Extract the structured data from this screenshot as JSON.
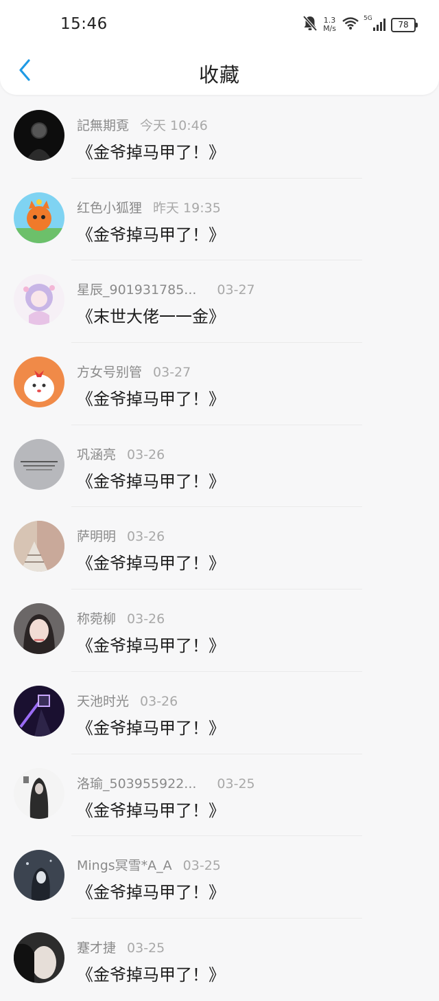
{
  "status_bar": {
    "time": "15:46",
    "net_speed_value": "1.3",
    "net_speed_unit": "M/s",
    "signal_label": "5G",
    "battery": "78"
  },
  "nav": {
    "title": "收藏",
    "back_icon": "chevron-left-icon"
  },
  "accent_color": "#1f9ae5",
  "items": [
    {
      "name": "記無期覔",
      "time": "今天 10:46",
      "book": "《金爷掉马甲了！》"
    },
    {
      "name": "红色小狐狸",
      "time": "昨天 19:35",
      "book": "《金爷掉马甲了！》"
    },
    {
      "name": "星辰_901931785...",
      "time": "03-27",
      "book": "《末世大佬一一金》"
    },
    {
      "name": "方女号别管",
      "time": "03-27",
      "book": "《金爷掉马甲了！》"
    },
    {
      "name": "巩涵亮",
      "time": "03-26",
      "book": "《金爷掉马甲了！》"
    },
    {
      "name": "萨明明",
      "time": "03-26",
      "book": "《金爷掉马甲了！》"
    },
    {
      "name": "称菀柳",
      "time": "03-26",
      "book": "《金爷掉马甲了！》"
    },
    {
      "name": "天池时光",
      "time": "03-26",
      "book": "《金爷掉马甲了！》"
    },
    {
      "name": "洛瑜_503955922...",
      "time": "03-25",
      "book": "《金爷掉马甲了！》"
    },
    {
      "name": "Mings冥雪*A_A",
      "time": "03-25",
      "book": "《金爷掉马甲了！》"
    },
    {
      "name": "蹇才捷",
      "time": "03-25",
      "book": "《金爷掉马甲了！》"
    }
  ]
}
